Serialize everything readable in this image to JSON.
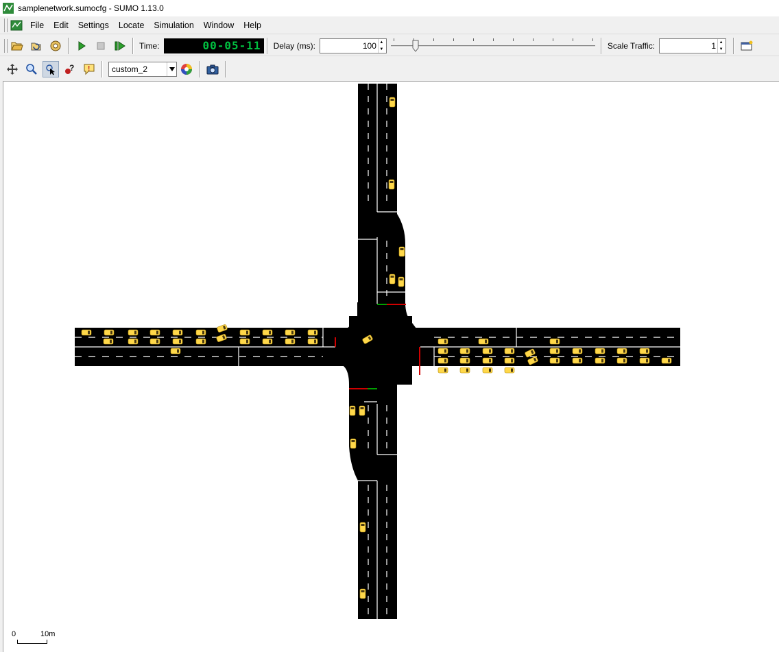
{
  "window": {
    "title": "samplenetwork.sumocfg - SUMO 1.13.0"
  },
  "menu": {
    "items": [
      {
        "name": "menu-file",
        "label": "File"
      },
      {
        "name": "menu-edit",
        "label": "Edit"
      },
      {
        "name": "menu-settings",
        "label": "Settings"
      },
      {
        "name": "menu-locate",
        "label": "Locate"
      },
      {
        "name": "menu-simulation",
        "label": "Simulation"
      },
      {
        "name": "menu-window",
        "label": "Window"
      },
      {
        "name": "menu-help",
        "label": "Help"
      }
    ]
  },
  "toolbar": {
    "time_label": "Time:",
    "time_value": "00-05-11",
    "delay_label": "Delay (ms):",
    "delay_value": "100",
    "scale_traffic_label": "Scale Traffic:",
    "scale_traffic_value": "1",
    "colour_scheme": "custom_2",
    "delay_slider_fraction": 0.1
  },
  "icons": {
    "open": "open-folder-icon",
    "reload": "reload-icon",
    "network": "network-icon",
    "run": "play-icon",
    "stop": "stop-icon",
    "step": "step-icon",
    "recenter": "recenter-icon",
    "zoom": "zoom-icon",
    "select": "select-cursor-icon",
    "query": "query-icon",
    "warning": "tooltip-icon",
    "palette": "color-wheel-icon",
    "screenshot": "camera-icon",
    "new_view": "new-view-icon"
  },
  "colors": {
    "road": "#000000",
    "lane_marking": "#ffffff",
    "vehicle": "#ffd84a",
    "tls_red": "#d00000",
    "tls_green": "#00a000",
    "time_digits": "#00c040"
  },
  "scale_bar": {
    "start_label": "0",
    "end_label": "10m"
  }
}
